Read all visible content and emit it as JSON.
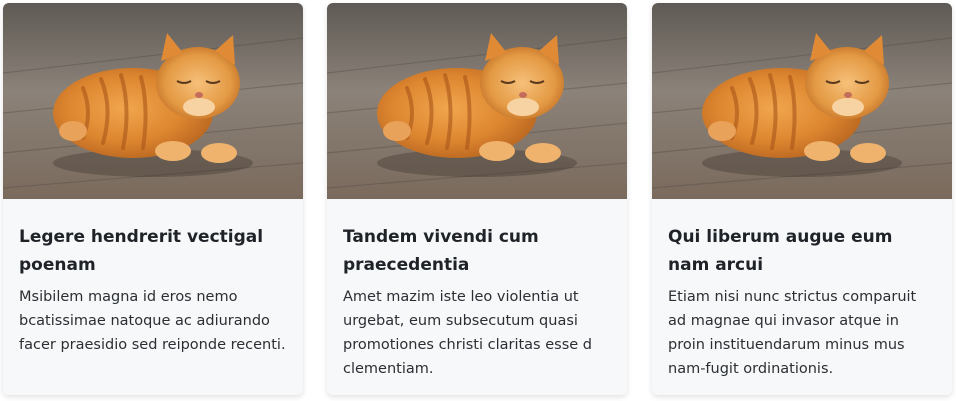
{
  "cards": [
    {
      "image_alt": "orange tabby cat lying on wooden floor",
      "title": "Legere hendrerit vectigal poenam",
      "text": "Msibilem magna id eros nemo bcatissimae natoque ac adiurando facer praesidio sed reiponde recenti."
    },
    {
      "image_alt": "orange tabby cat lying on wooden floor",
      "title": "Tandem vivendi cum praecedentia",
      "text": "Amet mazim iste leo violentia ut urgebat, eum subsecutum quasi promotiones christi claritas esse d clementiam."
    },
    {
      "image_alt": "orange tabby cat lying on wooden floor",
      "title": "Qui liberum augue eum nam arcui",
      "text": "Etiam nisi nunc strictus comparuit ad magnae qui invasor atque in proin instituendarum minus mus nam-fugit ordinationis."
    }
  ]
}
